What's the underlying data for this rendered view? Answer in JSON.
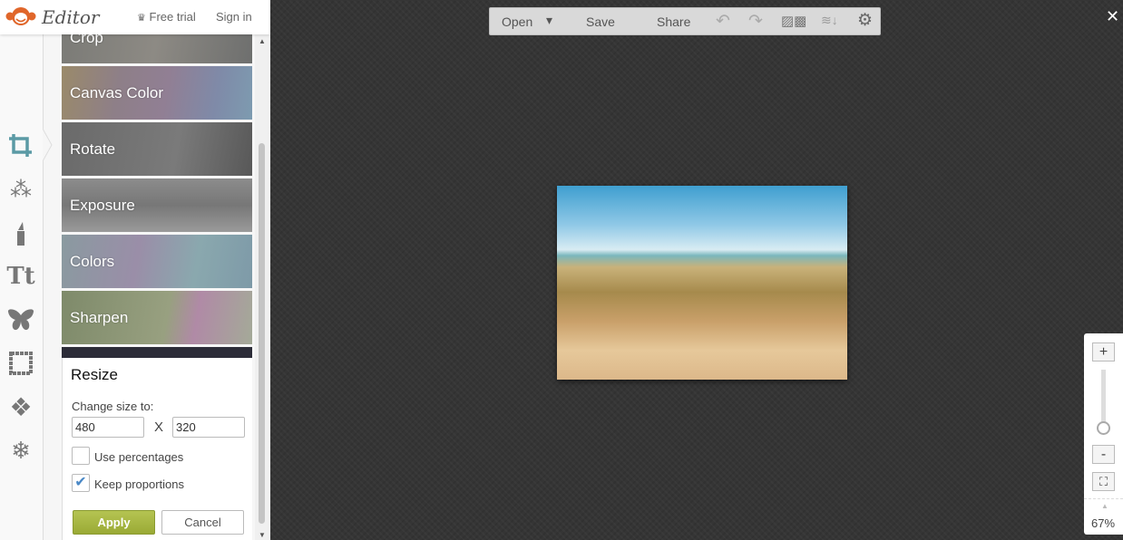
{
  "app": {
    "brand": "Editor",
    "free_trial": "Free trial",
    "sign_in": "Sign in"
  },
  "tools": [
    "crop-icon",
    "magic-wand-icon",
    "lipstick-icon",
    "text-icon",
    "butterfly-icon",
    "frame-icon",
    "texture-icon",
    "snowflake-icon"
  ],
  "tool_text_glyph": "Tt",
  "tiles": [
    {
      "label": "Crop"
    },
    {
      "label": "Canvas Color"
    },
    {
      "label": "Rotate"
    },
    {
      "label": "Exposure"
    },
    {
      "label": "Colors"
    },
    {
      "label": "Sharpen"
    }
  ],
  "resize": {
    "title": "Resize",
    "change_label": "Change size to:",
    "width": "480",
    "height": "320",
    "x_label": "X",
    "use_percentages": {
      "label": "Use percentages",
      "checked": false
    },
    "keep_proportions": {
      "label": "Keep proportions",
      "checked": true
    },
    "apply": "Apply",
    "cancel": "Cancel"
  },
  "toolbar": {
    "open": "Open",
    "save": "Save",
    "share": "Share"
  },
  "zoom": {
    "level": "67%",
    "plus": "+",
    "minus": "-",
    "slider_value_percent": 67
  },
  "colors": {
    "accent": "#5b9aa5",
    "apply": "#a9b842",
    "brand": "#e0662a"
  }
}
